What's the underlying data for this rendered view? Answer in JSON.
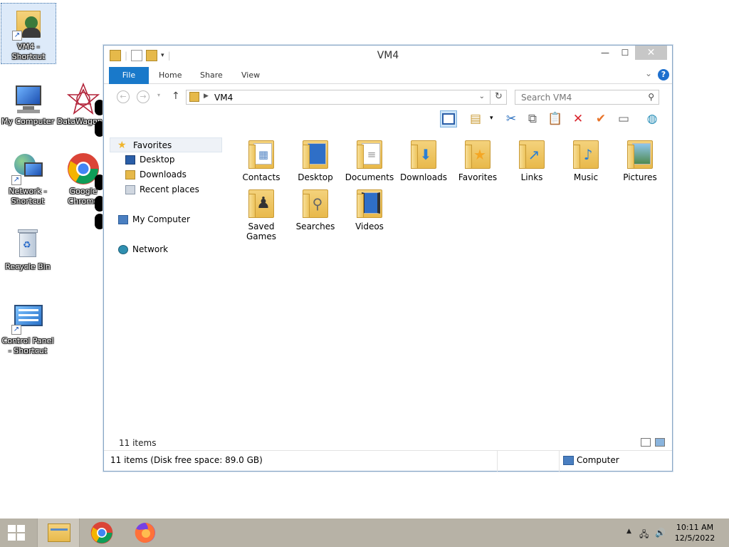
{
  "desktop": {
    "icons": [
      {
        "label": "VM4 -\nShortcut"
      },
      {
        "label": "My Computer"
      },
      {
        "label": "DataWagon..."
      },
      {
        "label": "Network -\nShortcut"
      },
      {
        "label": "Google\nChrome"
      },
      {
        "label": "Recycle Bin"
      },
      {
        "label": "Control Panel\n- Shortcut"
      }
    ]
  },
  "window": {
    "title": "VM4",
    "controls": {
      "minimize": "—",
      "maximize": "☐",
      "close": "✕"
    },
    "ribbon_tabs": [
      "File",
      "Home",
      "Share",
      "View"
    ],
    "help": "?",
    "address": {
      "path": "VM4"
    },
    "search": {
      "placeholder": "Search VM4"
    },
    "nav_pane": {
      "favorites": "Favorites",
      "favorite_items": [
        "Desktop",
        "Downloads",
        "Recent places"
      ],
      "my_computer": "My Computer",
      "network": "Network"
    },
    "items": [
      {
        "label": "Contacts",
        "emblem": "contacts-card"
      },
      {
        "label": "Desktop",
        "emblem": "desktop-screen"
      },
      {
        "label": "Documents",
        "emblem": "document-page"
      },
      {
        "label": "Downloads",
        "emblem": "down-arrow"
      },
      {
        "label": "Favorites",
        "emblem": "star"
      },
      {
        "label": "Links",
        "emblem": "link-arrow"
      },
      {
        "label": "Music",
        "emblem": "music-note"
      },
      {
        "label": "Pictures",
        "emblem": "picture"
      },
      {
        "label": "Saved\nGames",
        "emblem": "chess-piece"
      },
      {
        "label": "Searches",
        "emblem": "magnifier"
      },
      {
        "label": "Videos",
        "emblem": "film"
      }
    ],
    "item_count": "11 items",
    "status": {
      "left": "11 items (Disk free space: 89.0 GB)",
      "right": "Computer"
    }
  },
  "taskbar": {
    "time": "10:11 AM",
    "date": "12/5/2022",
    "buttons": [
      "file-explorer",
      "google-chrome",
      "firefox"
    ]
  },
  "colors": {
    "accent": "#1979ca",
    "taskbar": "#b7b2a6",
    "folder": "#e8b94b"
  }
}
